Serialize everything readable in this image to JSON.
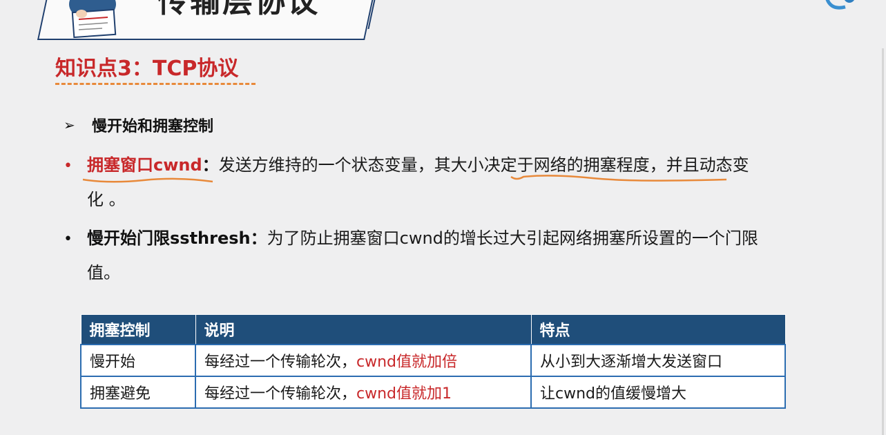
{
  "banner": {
    "title": "传输层协议"
  },
  "section": {
    "title": "知识点3：TCP协议"
  },
  "heading": {
    "arrow": "➢",
    "text": "慢开始和拥塞控制"
  },
  "bullets": [
    {
      "dot": "•",
      "term": "拥塞窗口cwnd",
      "sep": "：",
      "line1": "发送方维持的一个状态变量，其大小决定于网络的拥塞程度，并且动态变",
      "line2": "化 。"
    },
    {
      "dot": "•",
      "term": "慢开始门限ssthresh",
      "sep": "：",
      "line1": "为了防止拥塞窗口cwnd的增长过大引起网络拥塞所设置的一个门限",
      "line2": "值。"
    }
  ],
  "table": {
    "headers": [
      "拥塞控制",
      "说明",
      "特点"
    ],
    "rows": [
      {
        "name": "慢开始",
        "desc_prefix": "每经过一个传输轮次，",
        "desc_highlight": "cwnd值就加倍",
        "feature": "从小到大逐渐增大发送窗口"
      },
      {
        "name": "拥塞避免",
        "desc_prefix": "每经过一个传输轮次，",
        "desc_highlight": "cwnd值就加1",
        "feature": "让cwnd的值缓慢增大"
      }
    ]
  },
  "colors": {
    "title_red": "#c8282a",
    "underline_orange": "#e8893a",
    "table_header_blue": "#1f4e7a",
    "table_border_blue": "#2b6cb0",
    "background": "#efeff0"
  }
}
